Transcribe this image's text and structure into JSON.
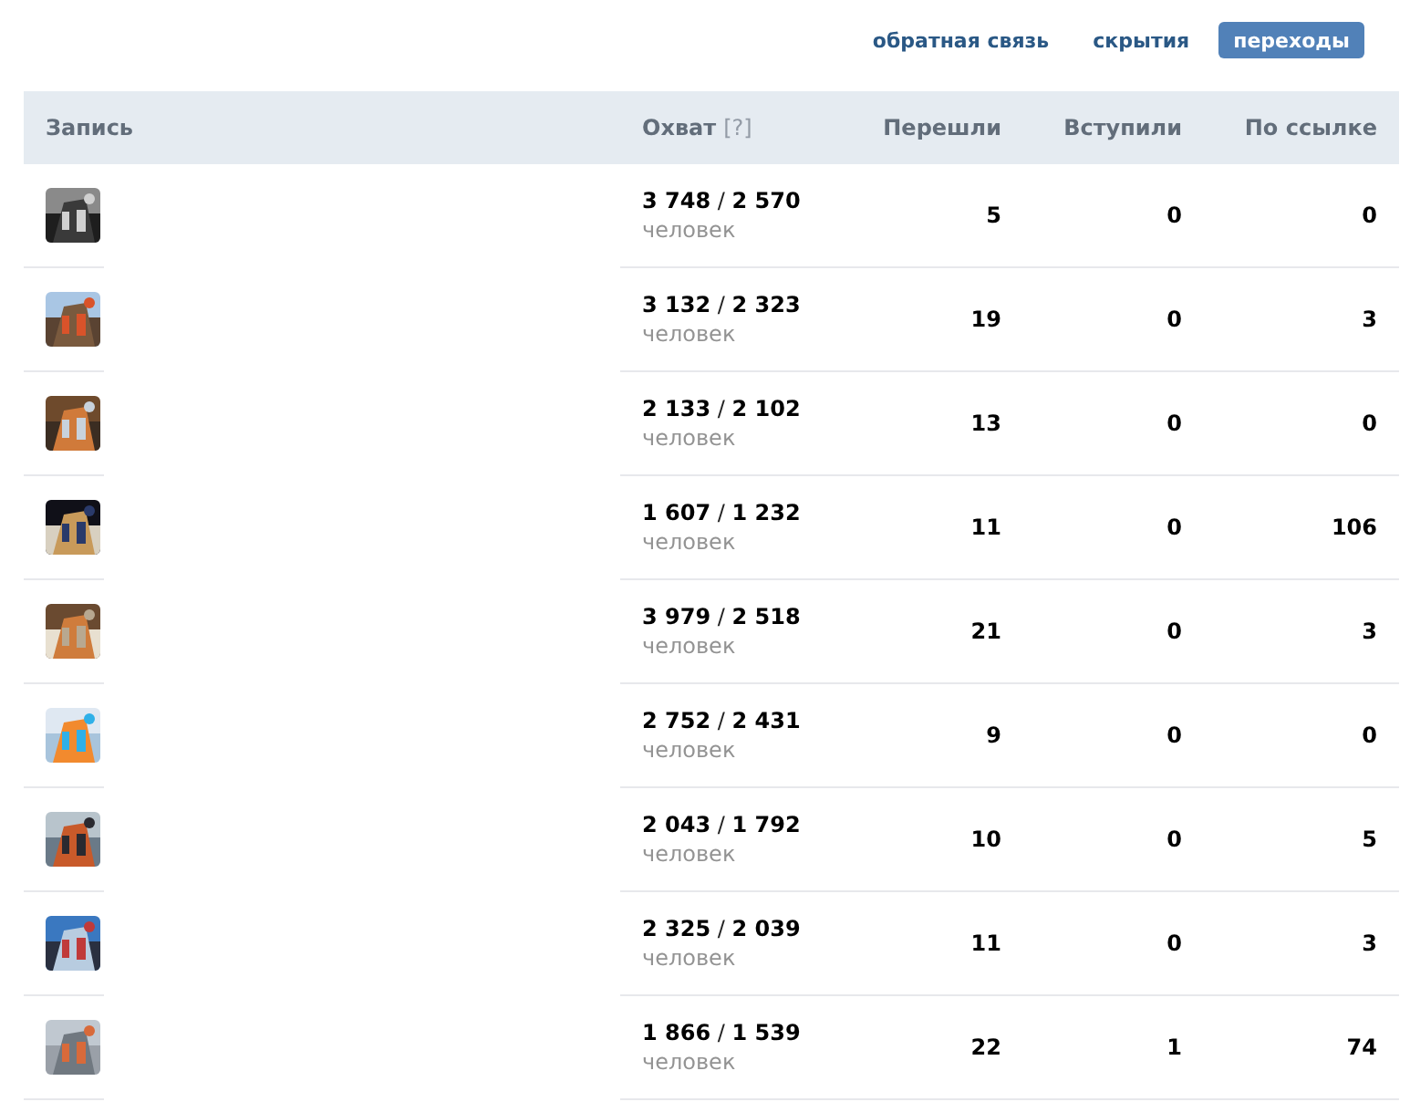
{
  "tabs": [
    {
      "label": "обратная связь",
      "selected": false
    },
    {
      "label": "скрытия",
      "selected": false
    },
    {
      "label": "переходы",
      "selected": true
    }
  ],
  "table": {
    "columns": [
      {
        "label": "Запись"
      },
      {
        "label": "Охват",
        "hint": "[?]"
      },
      {
        "label": "Перешли"
      },
      {
        "label": "Вступили"
      },
      {
        "label": "По ссылке"
      }
    ],
    "rows": [
      {
        "reach": "**3 748** / **2 570**",
        "unit": "человек",
        "clicks": "5",
        "joined": "0",
        "link": "0"
      },
      {
        "reach": "**3 132** / **2 323**",
        "unit": "человек",
        "clicks": "19",
        "joined": "0",
        "link": "3"
      },
      {
        "reach": "**2 133** / **2 102**",
        "unit": "человек",
        "clicks": "13",
        "joined": "0",
        "link": "0"
      },
      {
        "reach": "**1 607** / **1 232**",
        "unit": "человек",
        "clicks": "11",
        "joined": "0",
        "link": "106"
      },
      {
        "reach": "**3 979** / **2 518**",
        "unit": "человек",
        "clicks": "21",
        "joined": "0",
        "link": "3"
      },
      {
        "reach": "**2 752** / **2 431**",
        "unit": "человек",
        "clicks": "9",
        "joined": "0",
        "link": "0"
      },
      {
        "reach": "**2 043** / **1 792**",
        "unit": "человек",
        "clicks": "10",
        "joined": "0",
        "link": "5"
      },
      {
        "reach": "**2 325** / **2 039**",
        "unit": "человек",
        "clicks": "11",
        "joined": "0",
        "link": "3"
      },
      {
        "reach": "**1 866** / **1 539**",
        "unit": "человек",
        "clicks": "22",
        "joined": "1",
        "link": "74"
      }
    ]
  }
}
